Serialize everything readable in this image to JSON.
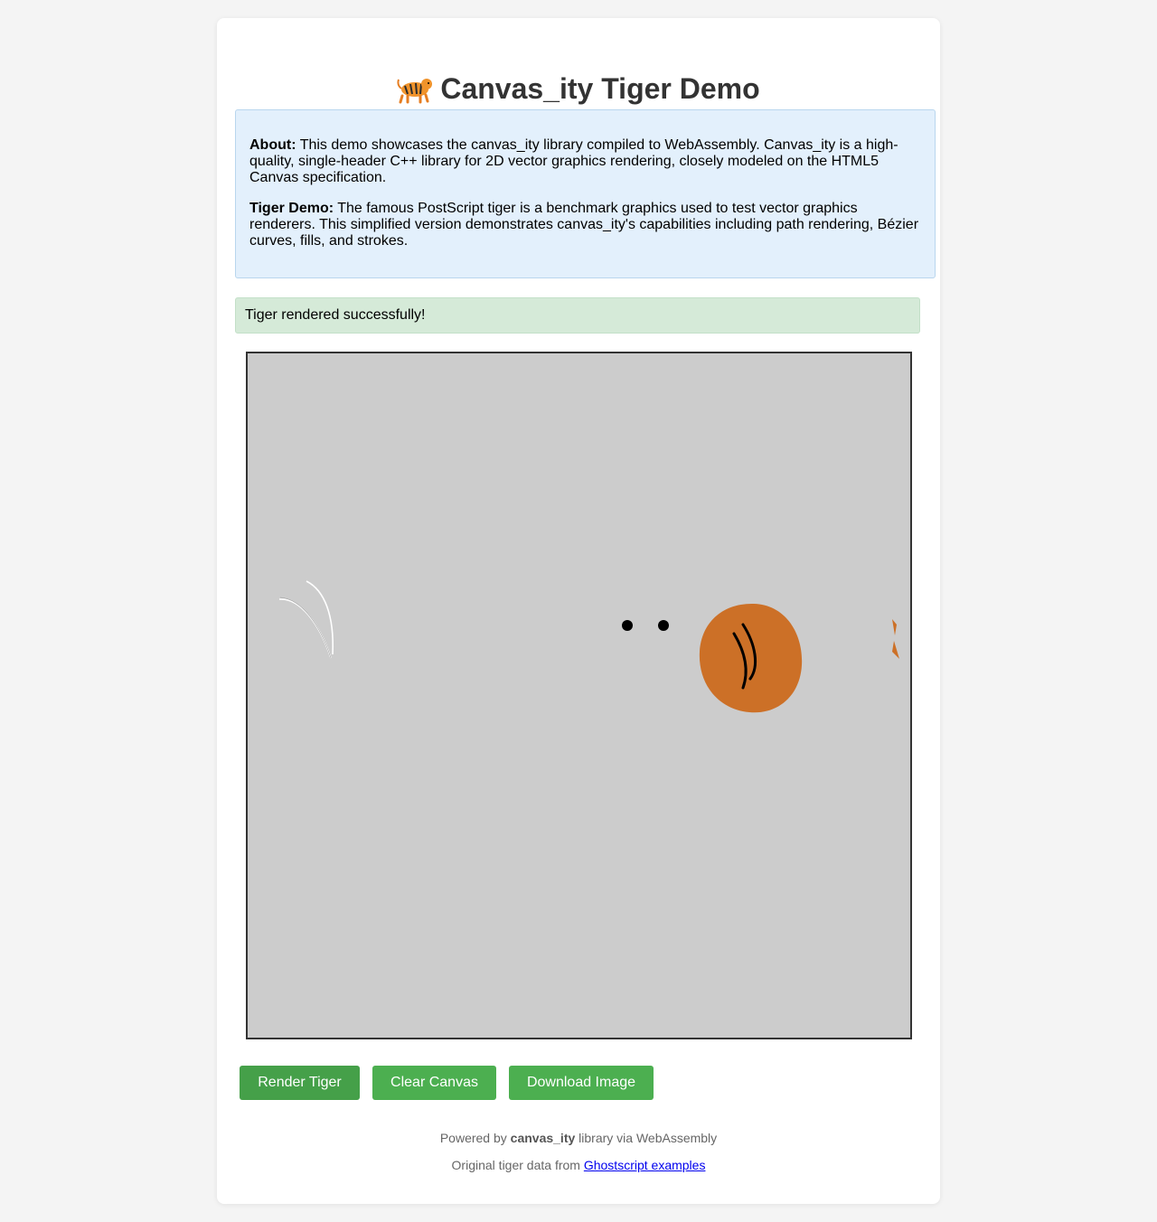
{
  "header": {
    "title": "Canvas_ity Tiger Demo",
    "emoji_icon": "tiger-emoji"
  },
  "about": {
    "about_label": "About:",
    "about_text": " This demo showcases the canvas_ity library compiled to WebAssembly. Canvas_ity is a high-quality, single-header C++ library for 2D vector graphics rendering, closely modeled on the HTML5 Canvas specification.",
    "tiger_label": "Tiger Demo:",
    "tiger_text": " The famous PostScript tiger is a benchmark graphics used to test vector graphics renderers. This simplified version demonstrates canvas_ity's capabilities including path rendering, Bézier curves, fills, and strokes."
  },
  "status": {
    "message": "Tiger rendered successfully!",
    "color": "#d5ead8"
  },
  "canvas": {
    "background": "#cccccc",
    "head_color": "#cc7027",
    "eye_color": "#000000"
  },
  "buttons": {
    "render": "Render Tiger",
    "clear": "Clear Canvas",
    "download": "Download Image",
    "color": "#4caf50"
  },
  "footer": {
    "powered_prefix": "Powered by ",
    "powered_lib": "canvas_ity",
    "powered_suffix": " library via WebAssembly",
    "credit_prefix": "Original tiger data from ",
    "credit_link": "Ghostscript examples"
  }
}
